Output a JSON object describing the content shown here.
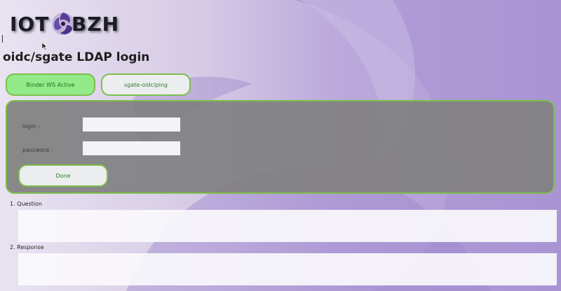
{
  "logo": {
    "left_text": "IOT",
    "right_text": "BZH"
  },
  "page": {
    "title": "oidc/sgate LDAP login"
  },
  "toolbar": {
    "binder_status_label": "Binder WS Active",
    "ping_label": "sgate-oidc/ping"
  },
  "form": {
    "login_label": "login :",
    "login_value": "",
    "password_label": "password :",
    "password_value": "",
    "done_label": "Done"
  },
  "sections": {
    "question_label": "1. Question",
    "question_content": "",
    "response_label": "2. Response",
    "response_content": ""
  },
  "colors": {
    "accent_border": "#7cbf4a",
    "active_button_bg": "#93ea88",
    "panel_bg": "#808080"
  },
  "icons": [
    "bzh-triskell-icon",
    "mouse-pointer-icon"
  ]
}
